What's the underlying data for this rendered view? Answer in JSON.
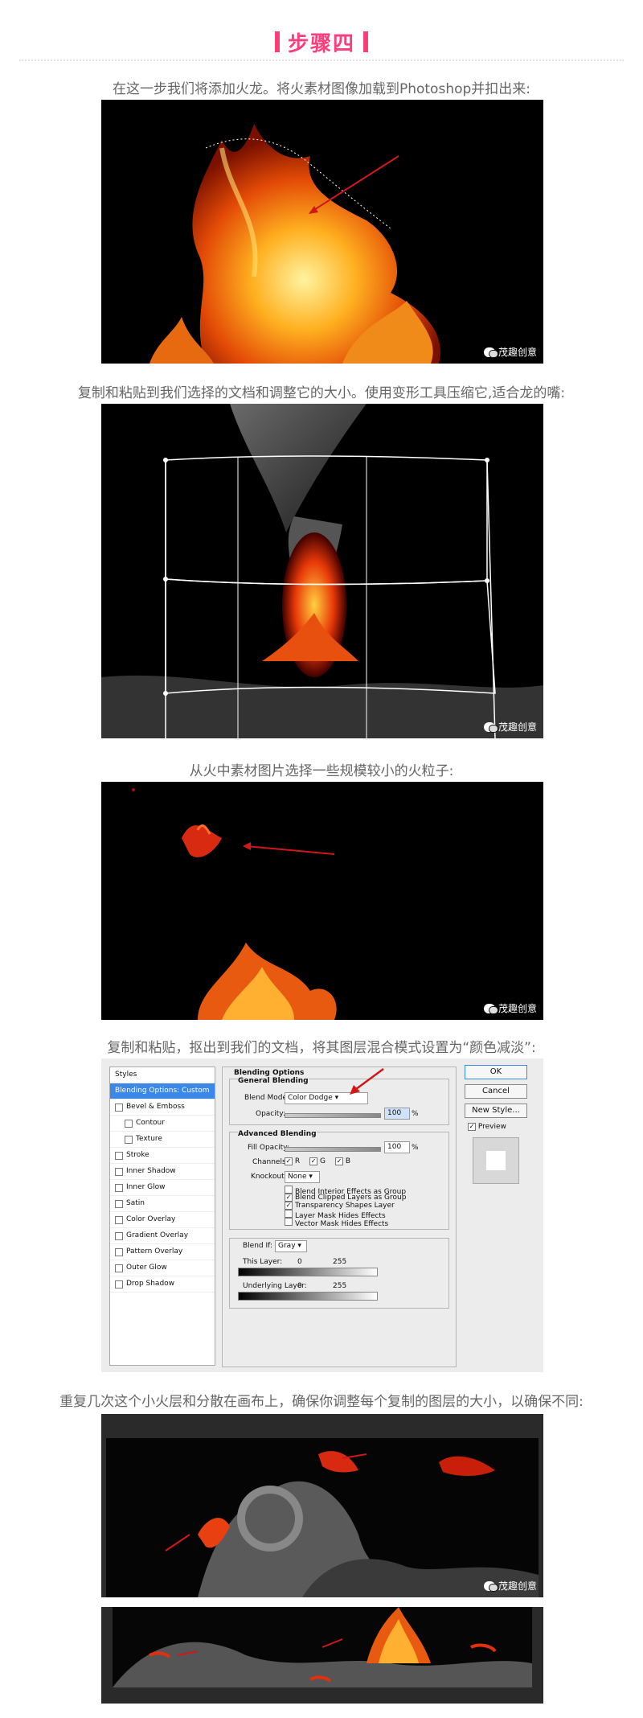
{
  "step": {
    "title": "步骤四"
  },
  "captions": [
    "在这一步我们将添加火龙。将火素材图像加载到Photoshop并扣出来:",
    "复制和粘贴到我们选择的文档和调整它的大小。使用变形工具压缩它,适合龙的嘴:",
    "从火中素材图片选择一些规模较小的火粒子:",
    "复制和粘贴，抠出到我们的文档，将其图层混合模式设置为“颜色减淡”:",
    "重复几次这个小火层和分散在画布上，确保你调整每个复制的图层的大小，以确保不同:"
  ],
  "watermark": "茂趣创意",
  "colors": {
    "accent": "#ff3d7a",
    "ps_select": "#3b88e8",
    "arrow": "#d01818"
  },
  "layer_style": {
    "styles_header": "Styles",
    "style_items": [
      {
        "label": "Blending Options: Custom",
        "checkbox": false,
        "selected": true,
        "indent": false
      },
      {
        "label": "Bevel & Emboss",
        "checkbox": true,
        "selected": false,
        "indent": false
      },
      {
        "label": "Contour",
        "checkbox": true,
        "selected": false,
        "indent": true
      },
      {
        "label": "Texture",
        "checkbox": true,
        "selected": false,
        "indent": true
      },
      {
        "label": "Stroke",
        "checkbox": true,
        "selected": false,
        "indent": false
      },
      {
        "label": "Inner Shadow",
        "checkbox": true,
        "selected": false,
        "indent": false
      },
      {
        "label": "Inner Glow",
        "checkbox": true,
        "selected": false,
        "indent": false
      },
      {
        "label": "Satin",
        "checkbox": true,
        "selected": false,
        "indent": false
      },
      {
        "label": "Color Overlay",
        "checkbox": true,
        "selected": false,
        "indent": false
      },
      {
        "label": "Gradient Overlay",
        "checkbox": true,
        "selected": false,
        "indent": false
      },
      {
        "label": "Pattern Overlay",
        "checkbox": true,
        "selected": false,
        "indent": false
      },
      {
        "label": "Outer Glow",
        "checkbox": true,
        "selected": false,
        "indent": false
      },
      {
        "label": "Drop Shadow",
        "checkbox": true,
        "selected": false,
        "indent": false
      }
    ],
    "blending_options": "Blending Options",
    "general_blending": "General Blending",
    "blend_mode_label": "Blend Mode:",
    "blend_mode_value": "Color Dodge",
    "opacity_label": "Opacity:",
    "opacity_value": "100",
    "percent": "%",
    "advanced_blending": "Advanced Blending",
    "fill_opacity_label": "Fill Opacity:",
    "fill_opacity_value": "100",
    "channels_label": "Channels:",
    "channel_r": "R",
    "channel_g": "G",
    "channel_b": "B",
    "knockout_label": "Knockout:",
    "knockout_value": "None",
    "adv_checks": [
      {
        "label": "Blend Interior Effects as Group",
        "checked": false
      },
      {
        "label": "Blend Clipped Layers as Group",
        "checked": true
      },
      {
        "label": "Transparency Shapes Layer",
        "checked": true
      },
      {
        "label": "Layer Mask Hides Effects",
        "checked": false
      },
      {
        "label": "Vector Mask Hides Effects",
        "checked": false
      }
    ],
    "blend_if_label": "Blend If:",
    "blend_if_value": "Gray",
    "this_layer": "This Layer:",
    "underlying_layer": "Underlying Layer:",
    "range_min": "0",
    "range_max": "255",
    "ok": "OK",
    "cancel": "Cancel",
    "new_style": "New Style...",
    "preview": "Preview"
  }
}
